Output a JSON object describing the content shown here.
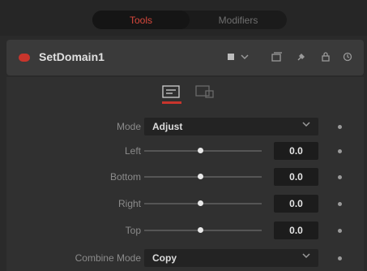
{
  "tabs": [
    {
      "label": "Tools",
      "active": true
    },
    {
      "label": "Modifiers",
      "active": false
    }
  ],
  "header": {
    "node_name": "SetDomain1",
    "icons": [
      "color-swatch-icon",
      "dropdown-chevron-icon",
      "versions-icon",
      "pin-icon",
      "lock-icon",
      "reset-icon"
    ]
  },
  "subtabs": [
    "controls-tab-icon",
    "settings-tab-icon"
  ],
  "controls": {
    "mode": {
      "label": "Mode",
      "value": "Adjust"
    },
    "left": {
      "label": "Left",
      "value": "0.0",
      "slider_fraction": 0.5
    },
    "bottom": {
      "label": "Bottom",
      "value": "0.0",
      "slider_fraction": 0.5
    },
    "right": {
      "label": "Right",
      "value": "0.0",
      "slider_fraction": 0.5
    },
    "top": {
      "label": "Top",
      "value": "0.0",
      "slider_fraction": 0.5
    },
    "combine_mode": {
      "label": "Combine Mode",
      "value": "Copy"
    }
  },
  "colors": {
    "accent": "#d7483c",
    "panel": "#303030",
    "field": "#1c1c1c"
  }
}
